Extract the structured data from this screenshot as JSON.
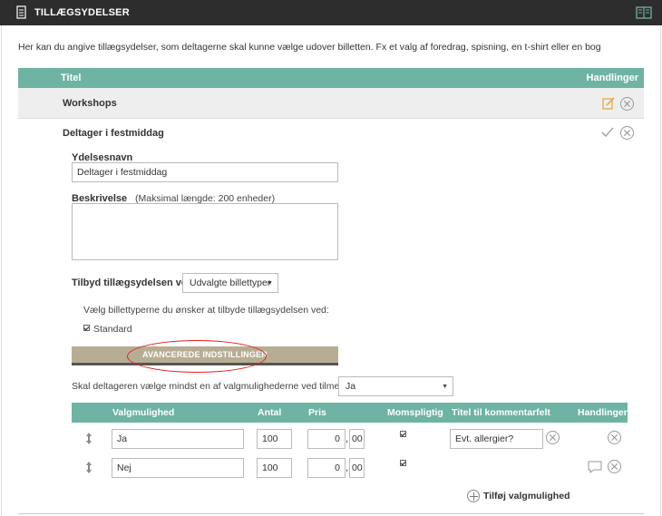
{
  "header": {
    "title": "TILLÆGSYDELSER",
    "title_icon": "document-icon",
    "right_icon": "book-icon"
  },
  "intro": "Her kan du angive tillægsydelser, som deltagerne skal kunne vælge udover billetten. Fx et valg af foredrag, spisning, en t-shirt eller en bog",
  "table": {
    "col_title": "Titel",
    "col_actions": "Handlinger"
  },
  "items": [
    {
      "name": "Workshops"
    },
    {
      "name": "Deltager i festmiddag"
    }
  ],
  "form": {
    "name_label": "Ydelsesnavn",
    "name_value": "Deltager i festmiddag",
    "desc_label": "Beskrivelse",
    "desc_hint": "(Maksimal længde: 200 enheder)",
    "offer_label": "Tilbyd tillægsydelsen ved:",
    "offer_value": "Udvalgte billettyper",
    "ticket_types_label": "Vælg billettyperne du ønsker at tilbyde tillægsydelsen ved:",
    "ticket_type_standard": "Standard",
    "advanced_button": "AVANCEREDE INDSTILLINGER",
    "must_choose_label": "Skal deltageren vælge mindst en af valgmulighederne ved tilmelding",
    "must_choose_value": "Ja"
  },
  "options_table": {
    "headers": {
      "option": "Valgmulighed",
      "quantity": "Antal",
      "price": "Pris",
      "vat": "Momspligtig",
      "comment_title": "Titel til kommentarfelt",
      "actions": "Handlinger"
    },
    "rows": [
      {
        "option": "Ja",
        "quantity": "100",
        "price_int": "0",
        "price_dec": "00",
        "vat": true,
        "comment_title": "Evt. allergier?"
      },
      {
        "option": "Nej",
        "quantity": "100",
        "price_int": "0",
        "price_dec": "00",
        "vat": true,
        "comment_title": ""
      }
    ],
    "comma": ",",
    "add_option": "Tilføj valgmulighed"
  },
  "colors": {
    "accent_teal": "#6eb3a4",
    "header_dark": "#2d2d2d",
    "button_tan": "#b6ad94",
    "highlight_red": "#e02020",
    "edit_orange": "#e8a23a"
  }
}
